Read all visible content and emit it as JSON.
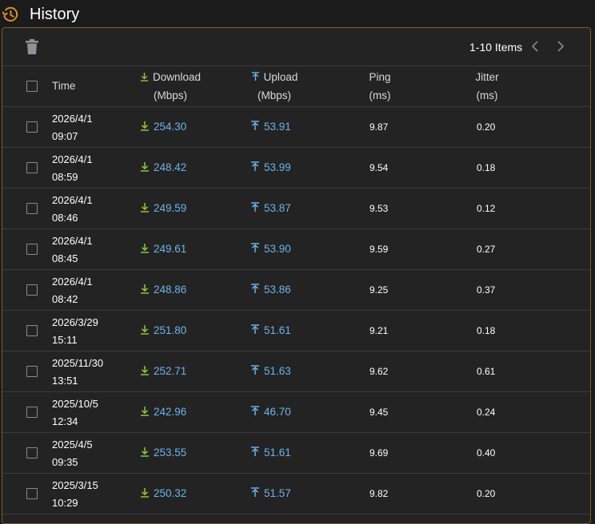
{
  "title": "History",
  "toolbar": {
    "items_label": "1-10 Items"
  },
  "colors": {
    "accent": "#d98f2b",
    "download_icon": "#8fc63f",
    "upload_icon": "#6db3ec",
    "value_text": "#6db3ec"
  },
  "columns": {
    "time": "Time",
    "download": "Download",
    "download_unit": "(Mbps)",
    "upload": "Upload",
    "upload_unit": "(Mbps)",
    "ping": "Ping",
    "ping_unit": "(ms)",
    "jitter": "Jitter",
    "jitter_unit": "(ms)"
  },
  "rows": [
    {
      "date": "2026/4/1",
      "time": "09:07",
      "download": "254.30",
      "upload": "53.91",
      "ping": "9.87",
      "jitter": "0.20"
    },
    {
      "date": "2026/4/1",
      "time": "08:59",
      "download": "248.42",
      "upload": "53.99",
      "ping": "9.54",
      "jitter": "0.18"
    },
    {
      "date": "2026/4/1",
      "time": "08:46",
      "download": "249.59",
      "upload": "53.87",
      "ping": "9.53",
      "jitter": "0.12"
    },
    {
      "date": "2026/4/1",
      "time": "08:45",
      "download": "249.61",
      "upload": "53.90",
      "ping": "9.59",
      "jitter": "0.27"
    },
    {
      "date": "2026/4/1",
      "time": "08:42",
      "download": "248.86",
      "upload": "53.86",
      "ping": "9.25",
      "jitter": "0.37"
    },
    {
      "date": "2026/3/29",
      "time": "15:11",
      "download": "251.80",
      "upload": "51.61",
      "ping": "9.21",
      "jitter": "0.18"
    },
    {
      "date": "2025/11/30",
      "time": "13:51",
      "download": "252.71",
      "upload": "51.63",
      "ping": "9.62",
      "jitter": "0.61"
    },
    {
      "date": "2025/10/5",
      "time": "12:34",
      "download": "242.96",
      "upload": "46.70",
      "ping": "9.45",
      "jitter": "0.24"
    },
    {
      "date": "2025/4/5",
      "time": "09:35",
      "download": "253.55",
      "upload": "51.61",
      "ping": "9.69",
      "jitter": "0.40"
    },
    {
      "date": "2025/3/15",
      "time": "10:29",
      "download": "250.32",
      "upload": "51.57",
      "ping": "9.82",
      "jitter": "0.20"
    }
  ]
}
